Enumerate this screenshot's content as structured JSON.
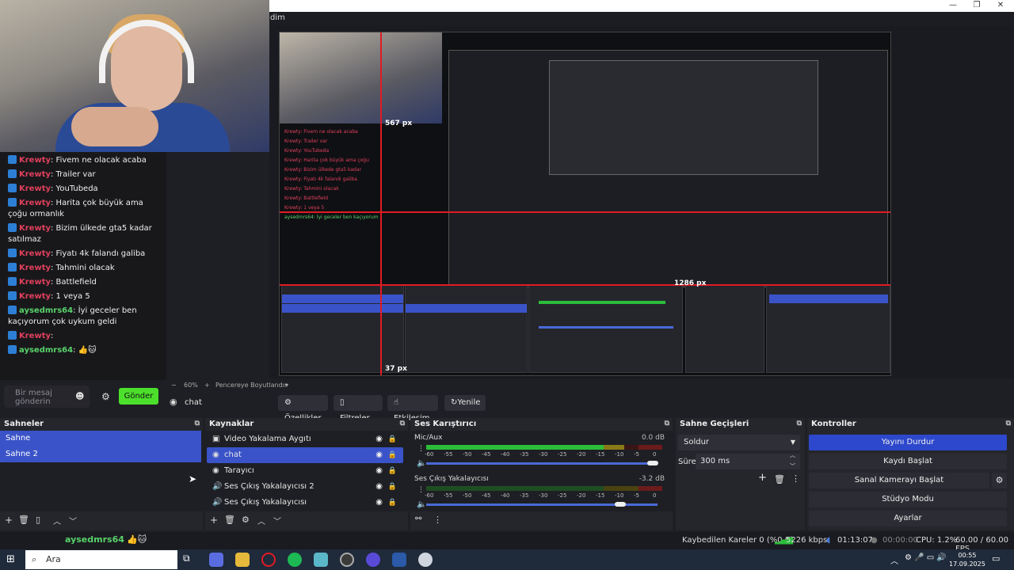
{
  "window": {
    "title_fragment": "dim"
  },
  "chat": {
    "messages": [
      {
        "user": "Krewty",
        "text": ": Fivem ne olacak acaba"
      },
      {
        "user": "Krewty",
        "text": ": Trailer var"
      },
      {
        "user": "Krewty",
        "text": ": YouTubeda"
      },
      {
        "user": "Krewty",
        "text": ": Harita çok büyük ama çoğu ormanlık"
      },
      {
        "user": "Krewty",
        "text": ": Bizim ülkede gta5 kadar satılmaz"
      },
      {
        "user": "Krewty",
        "text": ": Fiyatı 4k falandı galiba"
      },
      {
        "user": "Krewty",
        "text": ": Tahmini olacak"
      },
      {
        "user": "Krewty",
        "text": ": Battlefield"
      },
      {
        "user": "Krewty",
        "text": ": 1 veya 5"
      },
      {
        "user": "aysedmrs64",
        "text": ": İyi geceler ben kaçıyorum çok uykum geldi"
      },
      {
        "user": "Krewty",
        "text": ":"
      },
      {
        "user": "aysedmrs64",
        "text": ": 👍🐱"
      }
    ],
    "input_placeholder": "Bir mesaj gönderin",
    "send_label": "Gönder"
  },
  "preview": {
    "measure_labels": [
      "567 px",
      "1286 px",
      "37 px"
    ],
    "zoom": "60%",
    "zoom_minus": "−",
    "zoom_plus": "+",
    "fit_label": "Pencereye Boyutlandır"
  },
  "toolbar": {
    "selected_source": "chat",
    "properties": "Özellikler",
    "filters": "Filtreler",
    "interact": "Etkileşim",
    "refresh": "Yenile"
  },
  "scenes": {
    "title": "Sahneler",
    "items": [
      "Sahne",
      "Sahne 2"
    ]
  },
  "sources": {
    "title": "Kaynaklar",
    "items": [
      {
        "icon": "video-capture-icon",
        "label": "Video Yakalama Aygıtı"
      },
      {
        "icon": "browser-icon",
        "label": "chat",
        "selected": true
      },
      {
        "icon": "browser-icon",
        "label": "Tarayıcı"
      },
      {
        "icon": "speaker-icon",
        "label": "Ses Çıkış Yakalayıcısı 2"
      },
      {
        "icon": "speaker-icon",
        "label": "Ses Çıkış Yakalayıcısı"
      }
    ]
  },
  "mixer": {
    "title": "Ses Karıştırıcı",
    "scale": [
      "-60",
      "-55",
      "-50",
      "-45",
      "-40",
      "-35",
      "-30",
      "-25",
      "-20",
      "-15",
      "-10",
      "-5",
      "0"
    ],
    "channels": [
      {
        "name": "Mic/Aux",
        "db": "0.0 dB",
        "level": 0.84,
        "volume": 0.98
      },
      {
        "name": "Ses Çıkış Yakalayıcısı",
        "db": "-3.2 dB",
        "level": 0.0,
        "volume": 0.84
      }
    ]
  },
  "transitions": {
    "title": "Sahne Geçişleri",
    "selected": "Soldur",
    "duration_label": "Süre",
    "duration_value": "300 ms"
  },
  "controls": {
    "title": "Kontroller",
    "stop_stream": "Yayını Durdur",
    "start_recording": "Kaydı Başlat",
    "virtual_camera": "Sanal Kamerayı Başlat",
    "studio_mode": "Stüdyo Modu",
    "settings": "Ayarlar",
    "accent": "#2d48cc"
  },
  "statusbar": {
    "dropped_frames": "Kaybedilen Kareler 0 (%0.0)",
    "bitrate": "5226 kbps",
    "stream_time": "01:13:07",
    "record_time": "00:00:00",
    "cpu": "CPU: 1.2%",
    "fps": "60.00 / 60.00 FPS"
  },
  "taskbar": {
    "search_placeholder": "Ara",
    "time": "00:55",
    "date": "17.09.2025",
    "chat_overlay_user": "aysedmrs64",
    "chat_overlay_text": " 👍🐱"
  },
  "colors": {
    "selection": "#3a53c8",
    "twitch_name": "#e0405c",
    "twitch_green": "#58d26a",
    "send_button": "#4ce02c",
    "guide_red": "#e01b24"
  }
}
